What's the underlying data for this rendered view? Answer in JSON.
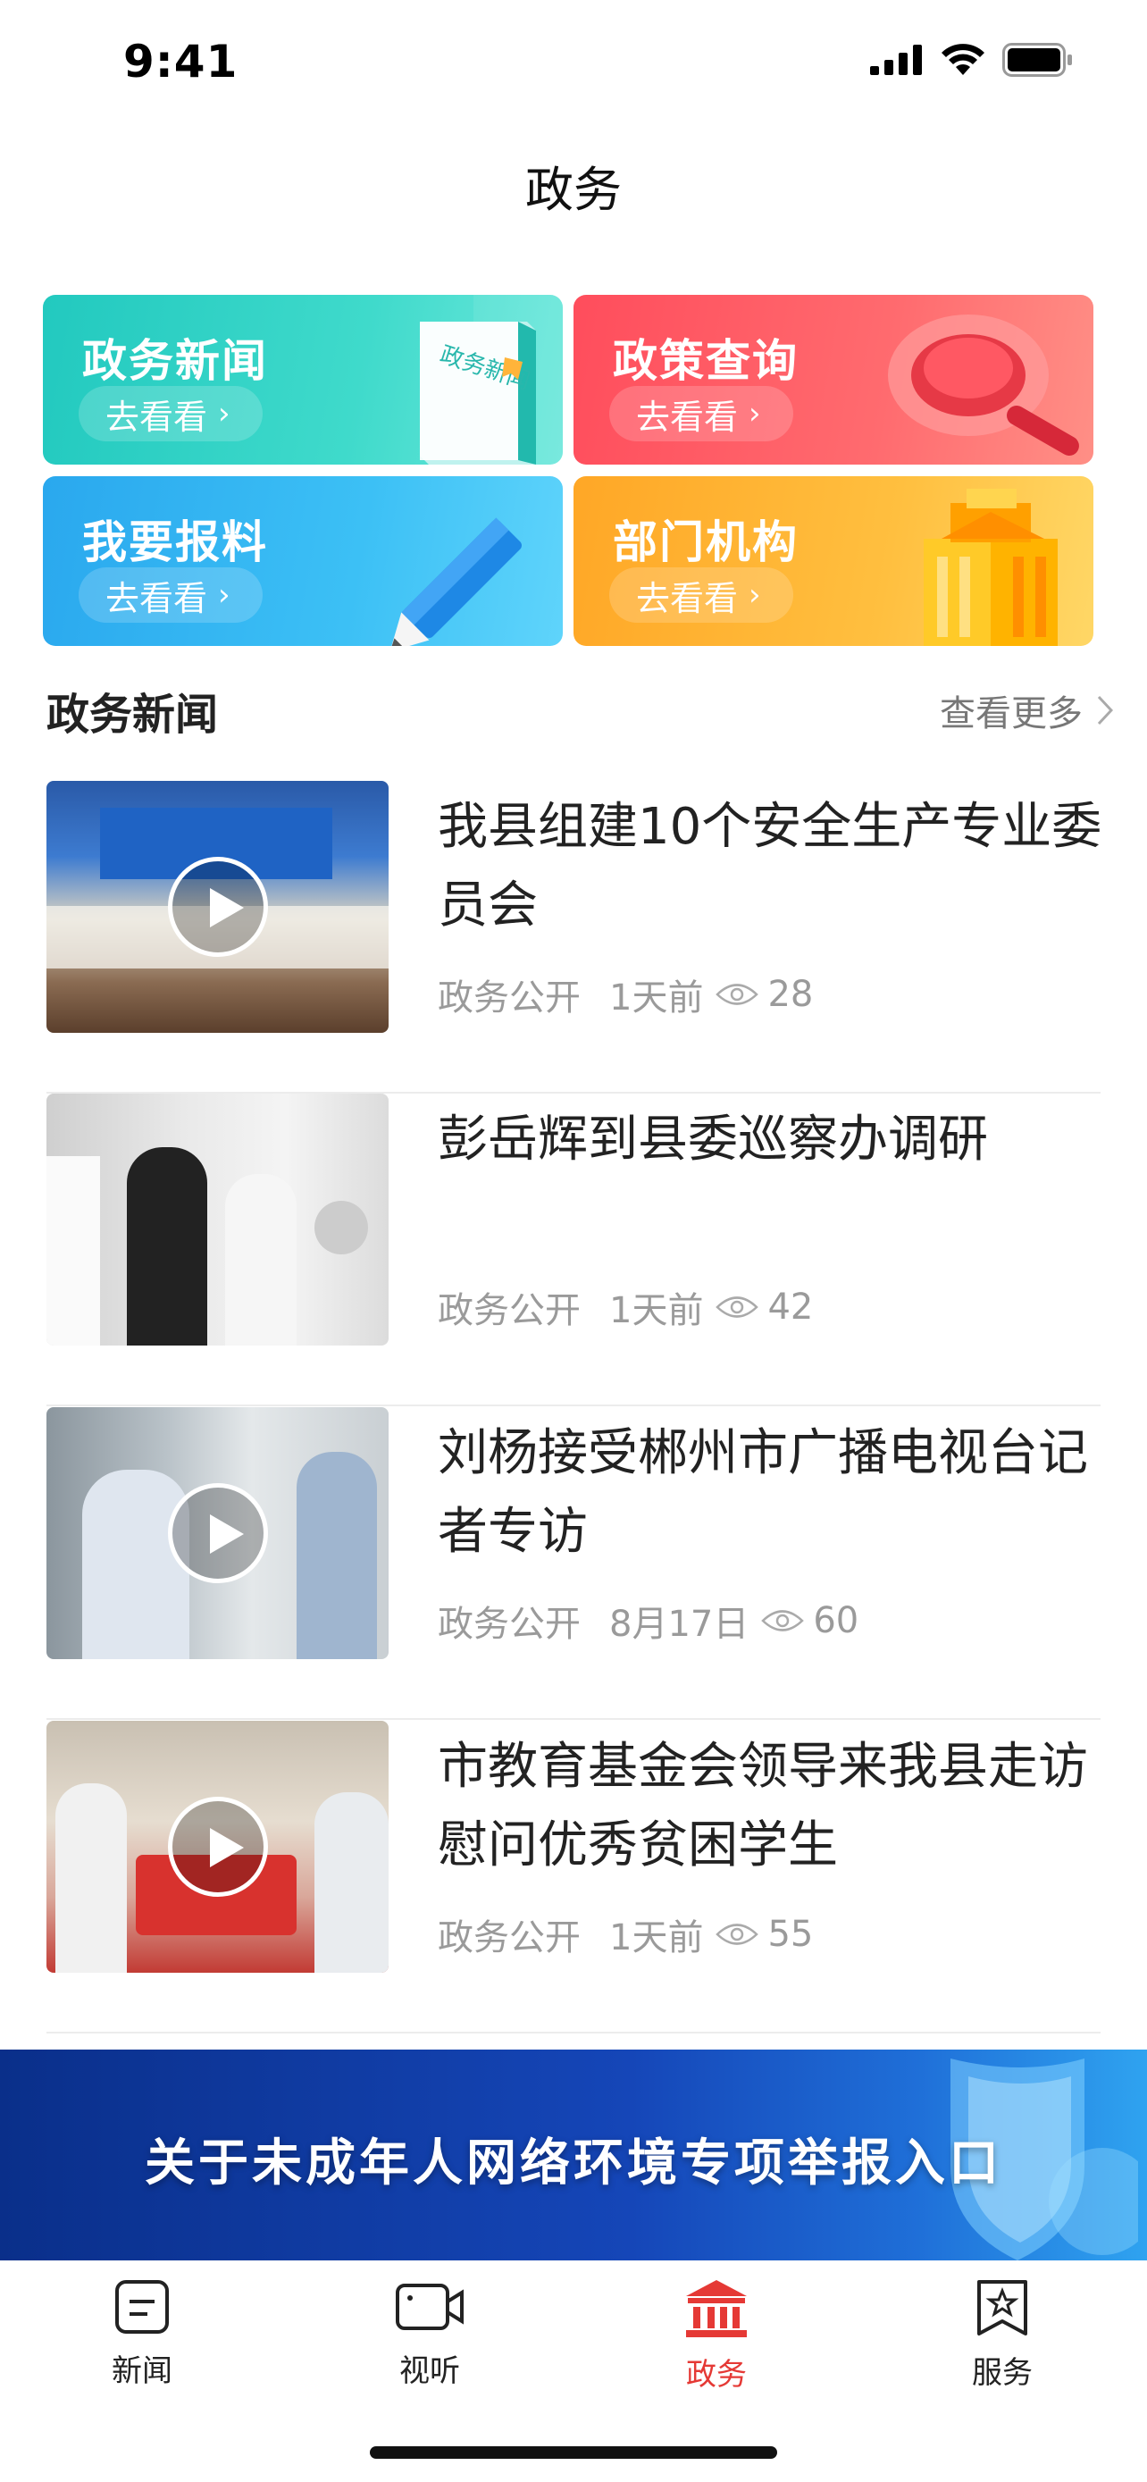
{
  "status_bar": {
    "time": "9:41"
  },
  "header": {
    "title": "政务"
  },
  "tiles": [
    {
      "title": "政务新闻",
      "button": "去看看",
      "color": "#2fd0c2",
      "art_text": "政务新闻"
    },
    {
      "title": "政策查询",
      "button": "去看看",
      "color": "#ff5b66"
    },
    {
      "title": "我要报料",
      "button": "去看看",
      "color": "#36b8f0"
    },
    {
      "title": "部门机构",
      "button": "去看看",
      "color": "#ffb43a"
    }
  ],
  "section": {
    "title": "政务新闻",
    "more": "查看更多"
  },
  "news": [
    {
      "title": "我县组建10个安全生产专业委员会",
      "category": "政务公开",
      "time": "1天前",
      "views": "28",
      "video": true
    },
    {
      "title": "彭岳辉到县委巡察办调研",
      "category": "政务公开",
      "time": "1天前",
      "views": "42",
      "video": false
    },
    {
      "title": "刘杨接受郴州市广播电视台记者专访",
      "category": "政务公开",
      "time": "8月17日",
      "views": "60",
      "video": true
    },
    {
      "title": "市教育基金会领导来我县走访慰问优秀贫困学生",
      "category": "政务公开",
      "time": "1天前",
      "views": "55",
      "video": true
    }
  ],
  "banner": {
    "text": "关于未成年人网络环境专项举报入口"
  },
  "tabbar": {
    "items": [
      {
        "label": "新闻",
        "icon": "news-icon"
      },
      {
        "label": "视听",
        "icon": "video-camera-icon"
      },
      {
        "label": "政务",
        "icon": "government-building-icon"
      },
      {
        "label": "服务",
        "icon": "bookmark-star-icon"
      }
    ],
    "active": 2,
    "active_color": "#e53935"
  }
}
